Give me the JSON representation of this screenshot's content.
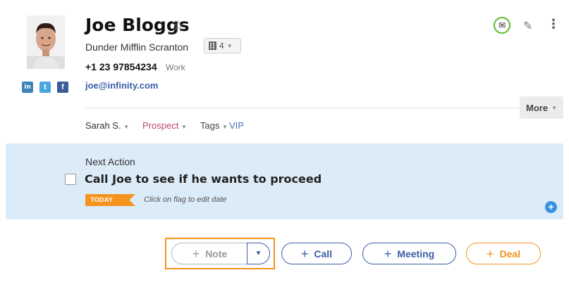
{
  "contact": {
    "name": "Joe Bloggs",
    "company": "Dunder Mifflin Scranton",
    "company_count": "4",
    "phone": "+1 23 97854234",
    "phone_type": "Work",
    "email": "joe@infinity.com"
  },
  "social": {
    "linkedin": "in",
    "twitter": "t",
    "facebook": "f"
  },
  "meta": {
    "owner": "Sarah S.",
    "status": "Prospect",
    "tags_label": "Tags",
    "tag": "VIP",
    "more": "More"
  },
  "next_action": {
    "label": "Next Action",
    "title": "Call Joe to see if he wants to proceed",
    "flag": "TODAY",
    "flag_hint": "Click on flag to edit date"
  },
  "actions": {
    "note": "Note",
    "call": "Call",
    "meeting": "Meeting",
    "deal": "Deal"
  },
  "colors": {
    "accent_blue": "#3b5ea6",
    "accent_orange": "#f5931e",
    "panel_bg": "#dcebf8",
    "status_color": "#c2456b"
  },
  "icons": {
    "star": "star-icon",
    "building": "building-icon",
    "email_sync": "email-sync-icon",
    "edit": "pencil-icon",
    "menu": "kebab-menu-icon",
    "add": "plus-circle-icon"
  }
}
